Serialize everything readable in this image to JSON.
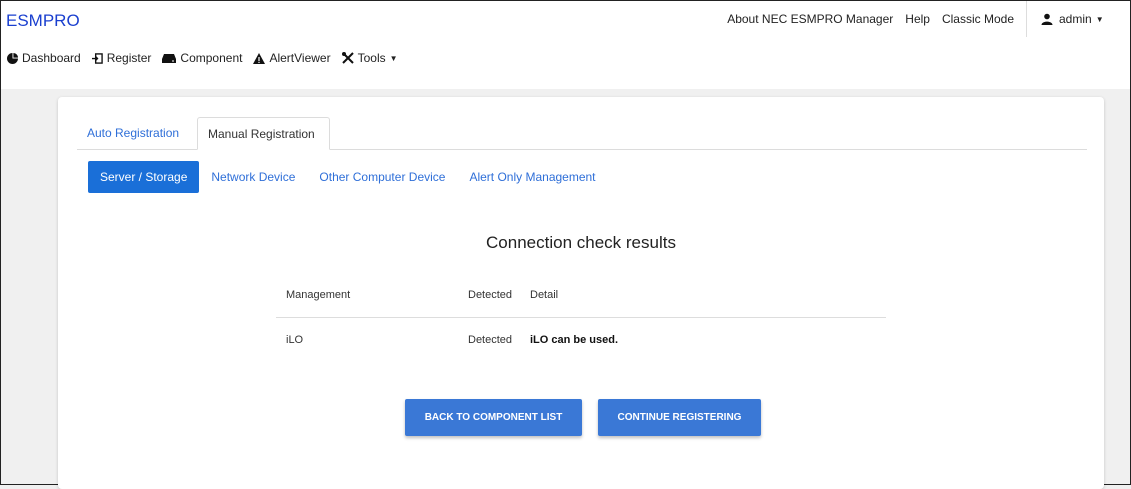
{
  "app": {
    "brand": "ESMPRO"
  },
  "top_links": {
    "about": "About NEC ESMPRO Manager",
    "help": "Help",
    "classic": "Classic Mode",
    "user": "admin"
  },
  "nav": [
    {
      "label": "Dashboard",
      "icon": "dashboard-icon"
    },
    {
      "label": "Register",
      "icon": "register-icon"
    },
    {
      "label": "Component",
      "icon": "component-icon"
    },
    {
      "label": "AlertViewer",
      "icon": "alert-icon"
    },
    {
      "label": "Tools",
      "icon": "tools-icon"
    }
  ],
  "tabs": {
    "auto": "Auto Registration",
    "manual": "Manual Registration",
    "active": "manual"
  },
  "subtabs": {
    "items": [
      "Server / Storage",
      "Network Device",
      "Other Computer Device",
      "Alert Only Management"
    ],
    "active": "Server / Storage"
  },
  "results": {
    "title": "Connection check results",
    "headers": [
      "Management",
      "Detected",
      "Detail"
    ],
    "rows": [
      {
        "management": "iLO",
        "detected": "Detected",
        "detail": "iLO can be used."
      }
    ]
  },
  "buttons": {
    "back": "BACK TO COMPONENT LIST",
    "continue": "CONTINUE REGISTERING"
  },
  "colors": {
    "brand": "#1a3fcf",
    "accent": "#1a6fd8",
    "button": "#3a78d6",
    "link": "#2f6fd8"
  }
}
